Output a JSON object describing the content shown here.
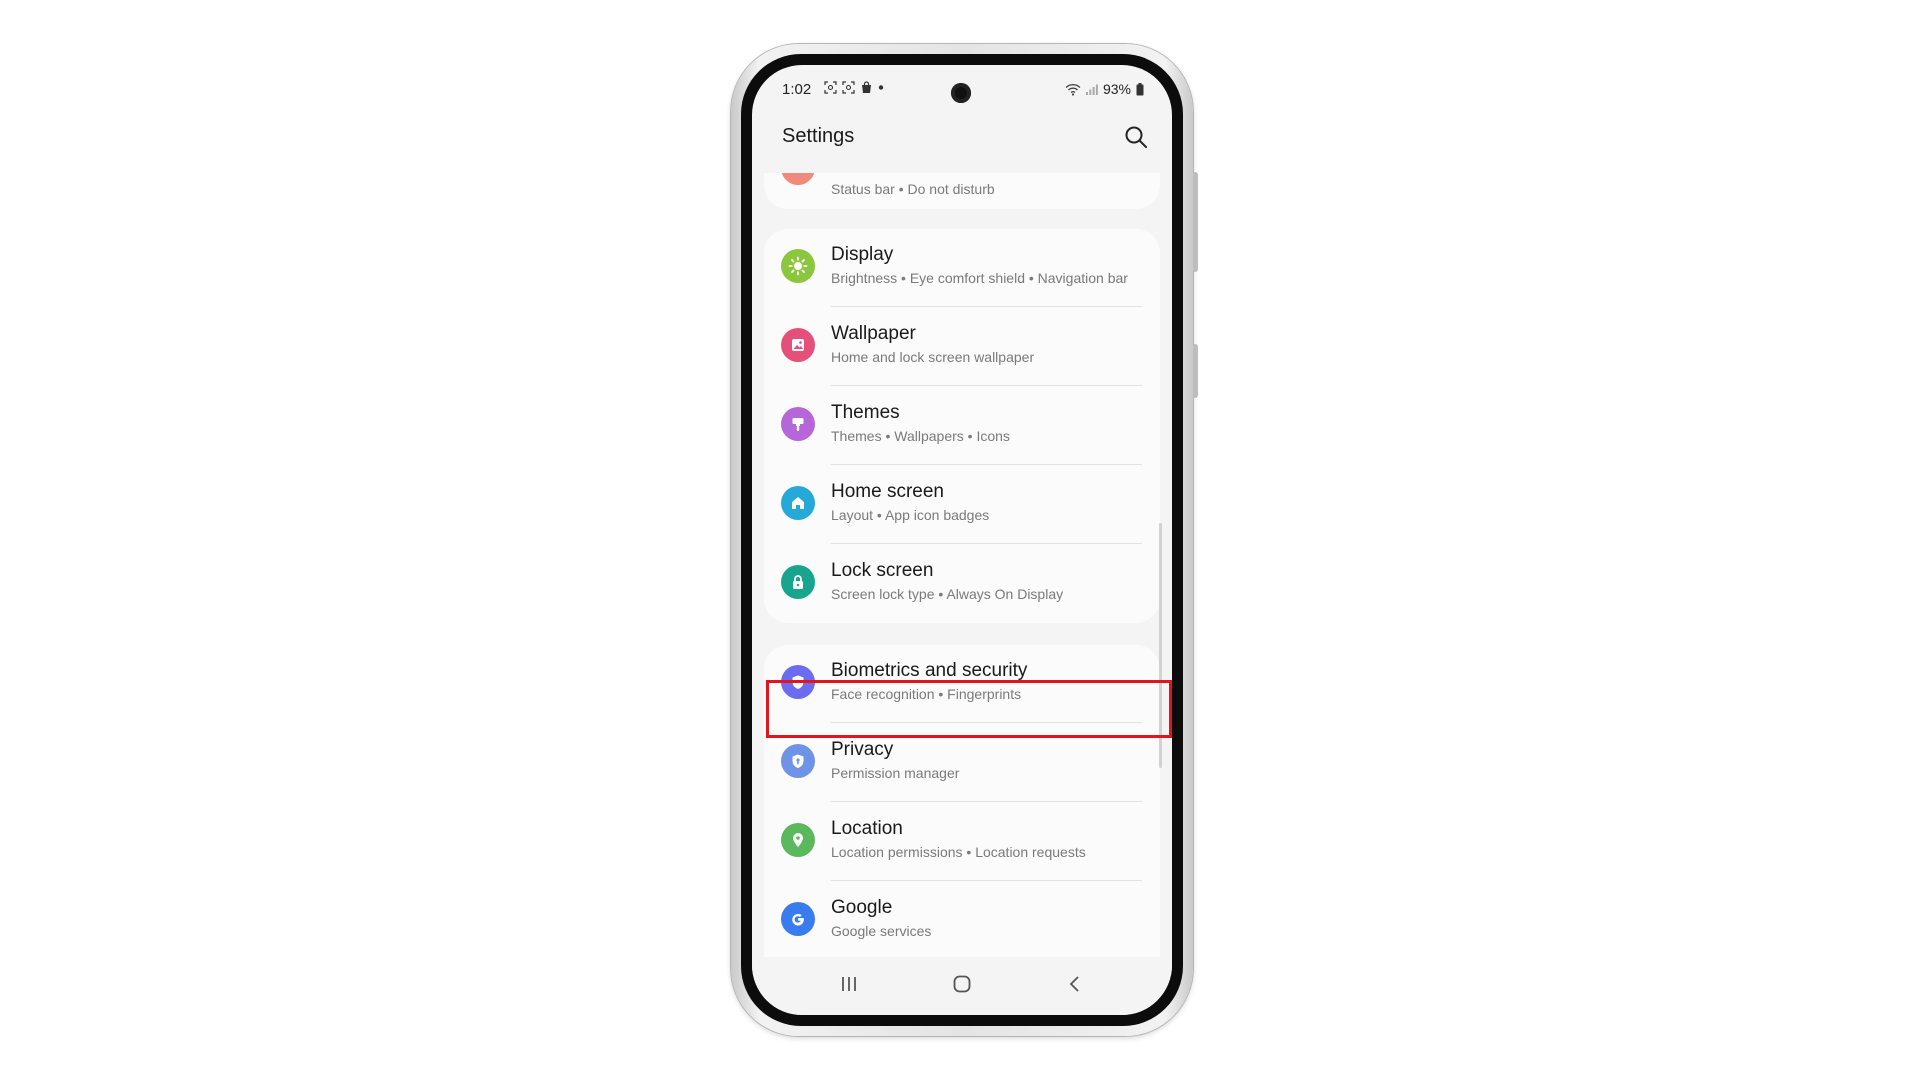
{
  "status_bar": {
    "time": "1:02",
    "battery": "93%"
  },
  "header": {
    "title": "Settings"
  },
  "partial_item": {
    "subtitle": "Status bar  •  Do not disturb"
  },
  "group1": [
    {
      "title": "Display",
      "subtitle": "Brightness  •  Eye comfort shield  •  Navigation bar",
      "icon": "sun-icon",
      "color": "#8cc63f"
    },
    {
      "title": "Wallpaper",
      "subtitle": "Home and lock screen wallpaper",
      "icon": "image-icon",
      "color": "#e5507a"
    },
    {
      "title": "Themes",
      "subtitle": "Themes  •  Wallpapers  •  Icons",
      "icon": "brush-icon",
      "color": "#b566d8"
    },
    {
      "title": "Home screen",
      "subtitle": "Layout  •  App icon badges",
      "icon": "home-icon",
      "color": "#25a9d9"
    },
    {
      "title": "Lock screen",
      "subtitle": "Screen lock type  •  Always On Display",
      "icon": "lock-icon",
      "color": "#17a58e"
    }
  ],
  "group2": [
    {
      "title": "Biometrics and security",
      "subtitle": "Face recognition  •  Fingerprints",
      "icon": "shield-icon",
      "color": "#6c6cf0"
    },
    {
      "title": "Privacy",
      "subtitle": "Permission manager",
      "icon": "privacy-shield-icon",
      "color": "#6f93e6"
    },
    {
      "title": "Location",
      "subtitle": "Location permissions  •  Location requests",
      "icon": "location-pin-icon",
      "color": "#5cb85c"
    },
    {
      "title": "Google",
      "subtitle": "Google services",
      "icon": "google-g-icon",
      "color": "#3a7bed"
    }
  ],
  "colors": {
    "highlight": "#e0151d",
    "partial_icon": "#f08a7c"
  }
}
